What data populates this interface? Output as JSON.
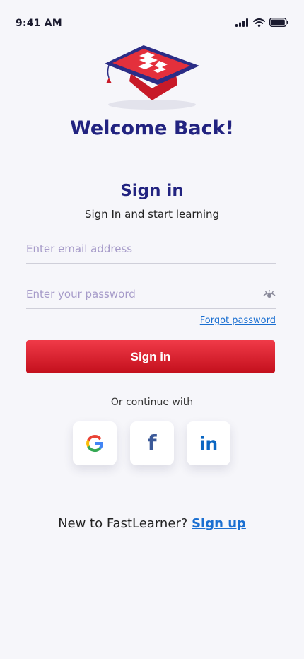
{
  "status_bar": {
    "time": "9:41 AM"
  },
  "header": {
    "welcome": "Welcome Back!"
  },
  "form": {
    "title": "Sign in",
    "subtitle": "Sign In and start learning",
    "email_placeholder": "Enter email address",
    "email_value": "",
    "password_placeholder": "Enter your password",
    "password_value": "",
    "forgot_label": "Forgot password",
    "submit_label": "Sign in"
  },
  "social": {
    "label": "Or continue with",
    "providers": [
      "google-icon",
      "facebook-icon",
      "linkedin-icon"
    ],
    "facebook_glyph": "f",
    "linkedin_glyph": "in"
  },
  "footer": {
    "text": "New to FastLearner?",
    "link": "Sign up"
  },
  "colors": {
    "primary": "#222380",
    "button": "#e0232e",
    "link": "#1a6fd1",
    "background": "#f6f6fa"
  }
}
